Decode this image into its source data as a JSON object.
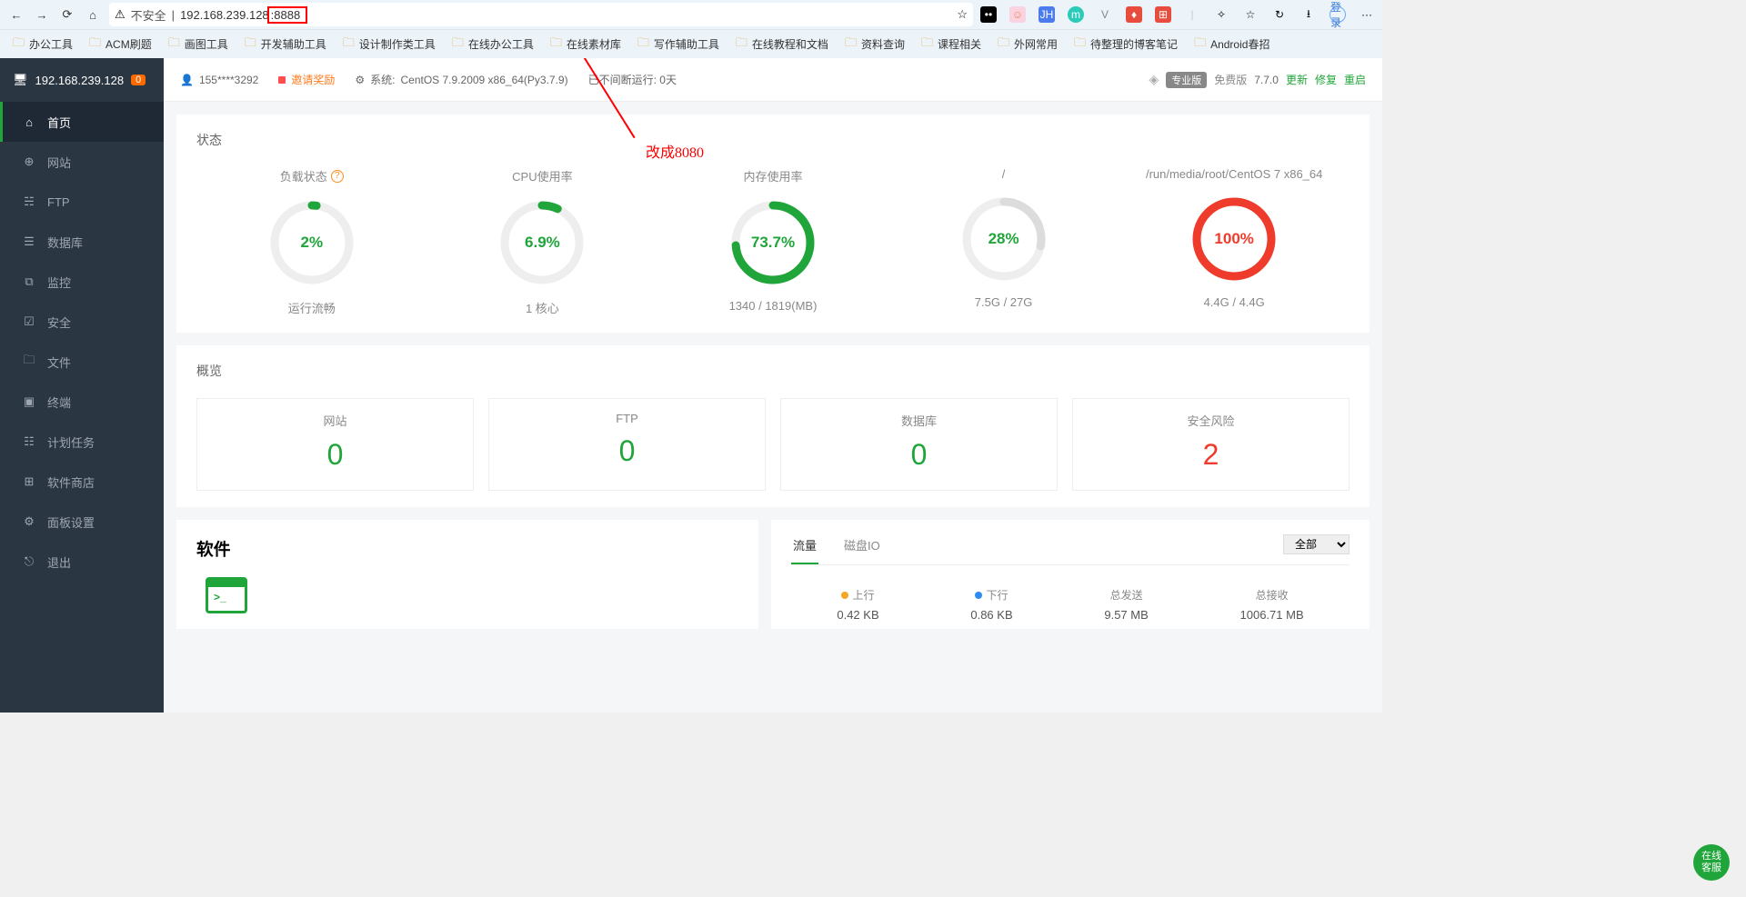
{
  "browser": {
    "unsafe_label": "不安全",
    "url_host": "192.168.239.128",
    "url_port": ":8888",
    "star": "☆",
    "login_label": "登录",
    "more": "···"
  },
  "bookmarks": [
    "办公工具",
    "ACM刷题",
    "画图工具",
    "开发辅助工具",
    "设计制作类工具",
    "在线办公工具",
    "在线素材库",
    "写作辅助工具",
    "在线教程和文档",
    "资料查询",
    "课程相关",
    "外网常用",
    "待整理的博客笔记",
    "Android春招"
  ],
  "sidebar": {
    "ip": "192.168.239.128",
    "badge": "0",
    "items": [
      {
        "icon": "⌂",
        "label": "首页"
      },
      {
        "icon": "⊕",
        "label": "网站"
      },
      {
        "icon": "☵",
        "label": "FTP"
      },
      {
        "icon": "☰",
        "label": "数据库"
      },
      {
        "icon": "⧉",
        "label": "监控"
      },
      {
        "icon": "☑",
        "label": "安全"
      },
      {
        "icon": "🗀",
        "label": "文件"
      },
      {
        "icon": "▣",
        "label": "终端"
      },
      {
        "icon": "☷",
        "label": "计划任务"
      },
      {
        "icon": "⊞",
        "label": "软件商店"
      },
      {
        "icon": "⚙",
        "label": "面板设置"
      },
      {
        "icon": "⎋",
        "label": "退出"
      }
    ]
  },
  "header": {
    "user": "155****3292",
    "invite": "邀请奖励",
    "sys_label": "系统:",
    "sys_value": "CentOS 7.9.2009 x86_64(Py3.7.9)",
    "uptime": "已不间断运行: 0天",
    "pro": "专业版",
    "free": "免费版",
    "ver": "7.7.0",
    "update": "更新",
    "fix": "修复",
    "restart": "重启"
  },
  "status": {
    "title": "状态",
    "gauges": [
      {
        "title": "负载状态",
        "pct": 2,
        "val": "2%",
        "sub": "运行流畅",
        "help": true
      },
      {
        "title": "CPU使用率",
        "pct": 6.9,
        "val": "6.9%",
        "sub": "1 核心"
      },
      {
        "title": "内存使用率",
        "pct": 73.7,
        "val": "73.7%",
        "sub": "1340 / 1819(MB)"
      },
      {
        "title": "/",
        "pct": 28,
        "val": "28%",
        "sub": "7.5G / 27G",
        "light": true
      },
      {
        "title": "/run/media/root/CentOS 7 x86_64",
        "pct": 100,
        "val": "100%",
        "sub": "4.4G / 4.4G",
        "red": true
      }
    ]
  },
  "overview": {
    "title": "概览",
    "items": [
      {
        "label": "网站",
        "value": "0"
      },
      {
        "label": "FTP",
        "value": "0"
      },
      {
        "label": "数据库",
        "value": "0"
      },
      {
        "label": "安全风险",
        "value": "2",
        "red": true
      }
    ]
  },
  "software": {
    "title": "软件"
  },
  "traffic": {
    "tabs": [
      "流量",
      "磁盘IO"
    ],
    "select": "全部",
    "cols": [
      {
        "dot": "o",
        "label": "上行",
        "value": "0.42 KB"
      },
      {
        "dot": "b",
        "label": "下行",
        "value": "0.86 KB"
      },
      {
        "dot": "",
        "label": "总发送",
        "value": "9.57 MB"
      },
      {
        "dot": "",
        "label": "总接收",
        "value": "1006.71 MB"
      }
    ]
  },
  "annotation": {
    "text": "改成8080"
  },
  "float": "在线\n客服"
}
